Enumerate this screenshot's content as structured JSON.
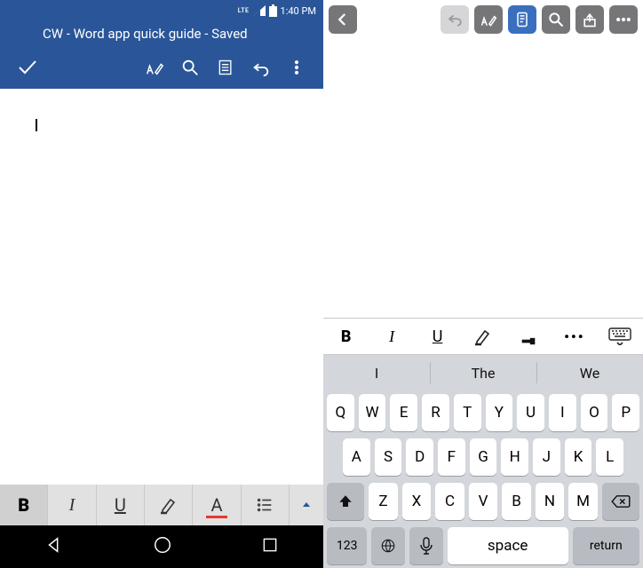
{
  "android": {
    "status": {
      "network": "LTE",
      "time": "1:40 PM"
    },
    "title": "CW - Word app quick guide - Saved",
    "format": {
      "bold": "B",
      "italic": "I",
      "underline": "U",
      "fontcolor": "A"
    }
  },
  "ios": {
    "predictions": [
      "I",
      "The",
      "We"
    ],
    "format": {
      "bold": "B",
      "italic": "I",
      "underline": "U",
      "more": "•••"
    },
    "keyboard": {
      "row1": [
        "Q",
        "W",
        "E",
        "R",
        "T",
        "Y",
        "U",
        "I",
        "O",
        "P"
      ],
      "row2": [
        "A",
        "S",
        "D",
        "F",
        "G",
        "H",
        "J",
        "K",
        "L"
      ],
      "row3": [
        "Z",
        "X",
        "C",
        "V",
        "B",
        "N",
        "M"
      ],
      "numkey": "123",
      "space": "space",
      "return": "return"
    }
  }
}
